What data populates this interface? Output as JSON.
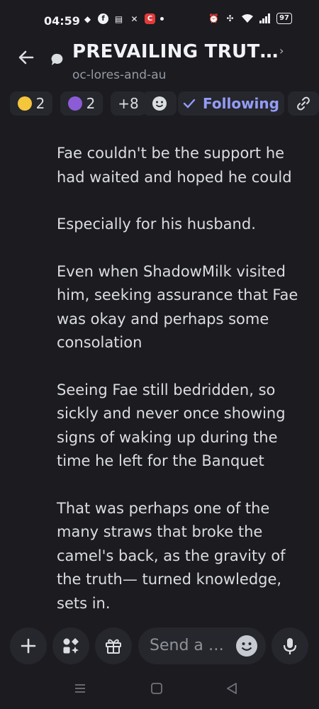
{
  "status_bar": {
    "time": "04:59",
    "battery": "97",
    "left_icons": [
      "game-controller-icon",
      "facebook-icon",
      "keyboard-icon",
      "x-icon",
      "app-notification-icon"
    ],
    "right_icons": [
      "alarm-icon",
      "vibrate-icon",
      "wifi-icon",
      "signal-icon"
    ]
  },
  "header": {
    "title": "PREVAILING TRUT…",
    "subtitle": "oc-lores-and-au"
  },
  "reactions": [
    {
      "emoji": "pleading-face",
      "count": "2"
    },
    {
      "emoji": "crystal-ball",
      "count": "2"
    }
  ],
  "more_reactions": "+8",
  "follow_label": "Following",
  "message": {
    "paragraphs": [
      "Fae couldn't be the support he had waited and hoped he could",
      "Especially for his husband.",
      "Even when ShadowMilk visited him, seeking assurance that Fae was okay and perhaps some consolation",
      "Seeing Fae still bedridden, so sickly and never once showing signs of waking up during the time he left for the Banquet",
      "That was perhaps one of the many straws that broke the camel's back, as the gravity of the truth— turned knowledge, sets in."
    ]
  },
  "composer": {
    "placeholder": "Send a …"
  },
  "colors": {
    "background": "#1b1b20",
    "chip": "#26272d",
    "accent": "#949cf7"
  }
}
